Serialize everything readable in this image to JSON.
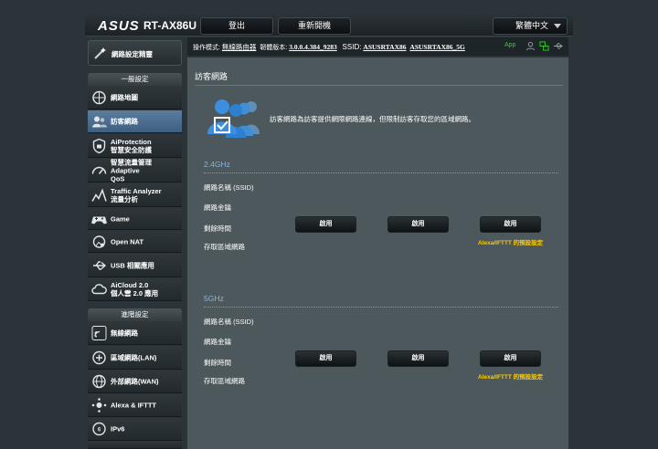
{
  "header": {
    "logo": "ASUS",
    "model": "RT-AX86U",
    "logout_label": "登出",
    "reboot_label": "重新開機",
    "language": "繁體中文"
  },
  "status": {
    "mode_label": "操作模式:",
    "mode_value": "無線路由器",
    "firmware_label": "韌體版本:",
    "firmware_value": "3.0.0.4.384_9283",
    "ssid_label": "SSID:",
    "ssid_24": "ASUSRTAX86",
    "ssid_5": "ASUSRTAX86_5G",
    "app_label": "App"
  },
  "sidebar": {
    "qis_label": "網路設定精靈",
    "general_header": "一般設定",
    "general_items": [
      {
        "label": "網路地圖",
        "icon": "network-map-icon"
      },
      {
        "label": "訪客網路",
        "icon": "guest-network-icon",
        "active": true
      },
      {
        "label": "AiProtection\n智慧安全防護",
        "icon": "aiprotection-icon"
      },
      {
        "label": "智慧流量管理 Adaptive\nQoS",
        "icon": "qos-gauge-icon"
      },
      {
        "label": "Traffic Analyzer\n流量分析",
        "icon": "traffic-analyzer-icon"
      },
      {
        "label": "Game",
        "icon": "game-controller-icon"
      },
      {
        "label": "Open NAT",
        "icon": "open-nat-icon"
      },
      {
        "label": "USB 相關應用",
        "icon": "usb-icon"
      },
      {
        "label": "AiCloud 2.0\n個人雲 2.0 應用",
        "icon": "aicloud-icon"
      }
    ],
    "advanced_header": "進階設定",
    "advanced_items": [
      {
        "label": "無線網路",
        "icon": "wireless-icon"
      },
      {
        "label": "區域網路(LAN)",
        "icon": "lan-icon"
      },
      {
        "label": "外部網路(WAN)",
        "icon": "wan-globe-icon"
      },
      {
        "label": "Alexa & IFTTT",
        "icon": "alexa-icon"
      },
      {
        "label": "IPv6",
        "icon": "ipv6-icon"
      }
    ]
  },
  "main": {
    "title": "訪客網路",
    "description": "訪客網路為訪客提供網際網路連線，但限制訪客存取您的區域網路。",
    "row_labels": [
      "網路名稱 (SSID)",
      "網路金鑰",
      "剩餘時間",
      "存取區域網路"
    ],
    "bands": [
      {
        "name": "2.4GHz",
        "buttons": [
          "啟用",
          "啟用",
          "啟用"
        ],
        "alexa_note": "Alexa/IFTTT 的預設設定"
      },
      {
        "name": "5GHz",
        "buttons": [
          "啟用",
          "啟用",
          "啟用"
        ],
        "alexa_note": "Alexa/IFTTT 的預設設定"
      }
    ]
  },
  "colors": {
    "accent_blue": "#3f8fd6",
    "band_blue": "#8fb4d6",
    "alexa_yellow": "#ffcc00",
    "app_green": "#2fd31d"
  }
}
